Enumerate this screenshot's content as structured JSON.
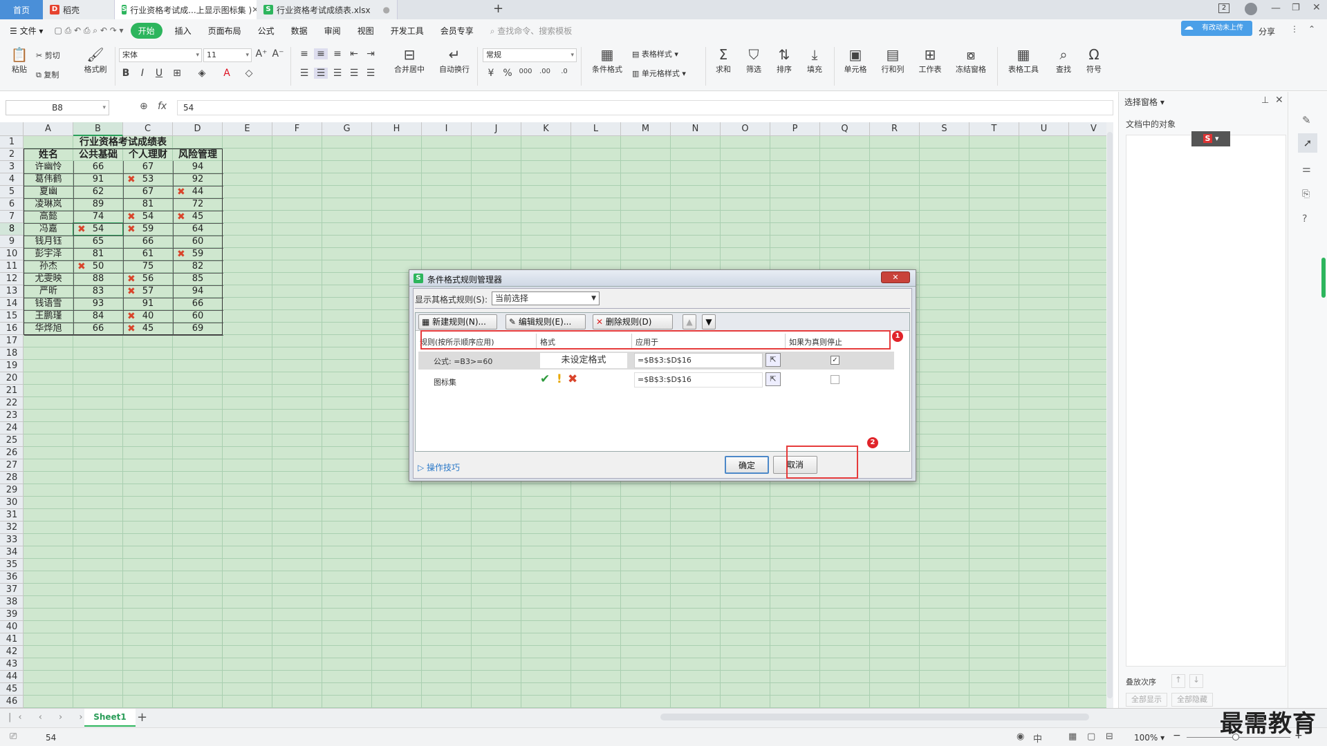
{
  "tabs": {
    "home": "首页",
    "daoke": "稻壳",
    "active": "行业资格考试成...上显示图标集 )",
    "other": "行业资格考试成绩表.xlsx"
  },
  "menu": [
    "文件",
    "开始",
    "插入",
    "页面布局",
    "公式",
    "数据",
    "审阅",
    "视图",
    "开发工具",
    "会员专享"
  ],
  "search_placeholder": "查找命令、搜索模板",
  "top_right": {
    "badge": "2",
    "share": "分享",
    "cloud": "有改动未上传"
  },
  "ribbon": {
    "paste": "粘贴",
    "cut": "剪切",
    "copy": "复制",
    "format_painter": "格式刷",
    "font": "宋体",
    "size": "11",
    "number_format": "常规",
    "merge": "合并居中",
    "wrap": "自动换行",
    "cond_format": "条件格式",
    "table_style": "表格样式",
    "cell_style": "单元格样式",
    "sum": "求和",
    "filter": "筛选",
    "sort": "排序",
    "fill": "填充",
    "cell": "单元格",
    "rowcol": "行和列",
    "worksheet": "工作表",
    "freeze": "冻结窗格",
    "table_tools": "表格工具",
    "find": "查找",
    "symbol": "符号"
  },
  "formula_bar": {
    "name_box": "B8",
    "fx": "fx",
    "value": "54"
  },
  "columns": [
    "A",
    "B",
    "C",
    "D",
    "E",
    "F",
    "G",
    "H",
    "I",
    "J",
    "K",
    "L",
    "M",
    "N",
    "O",
    "P",
    "Q",
    "R",
    "S",
    "T",
    "U",
    "V"
  ],
  "rows": [
    "1",
    "2",
    "3",
    "4",
    "5",
    "6",
    "7",
    "8",
    "9",
    "10",
    "11",
    "12",
    "13",
    "14",
    "15",
    "16",
    "17",
    "18",
    "19",
    "20",
    "21",
    "22",
    "23",
    "24",
    "25",
    "26",
    "27",
    "28",
    "29",
    "30",
    "31",
    "32",
    "33",
    "34",
    "35",
    "36",
    "37",
    "38",
    "39",
    "40",
    "41",
    "42",
    "43",
    "44",
    "45",
    "46"
  ],
  "sheet": {
    "title": "行业资格考试成绩表",
    "headers": [
      "姓名",
      "公共基础",
      "个人理财",
      "风险管理"
    ],
    "data": [
      [
        "许幽怜",
        "66",
        "67",
        "94"
      ],
      [
        "葛伟鹤",
        "91",
        "53",
        "92"
      ],
      [
        "夏幽",
        "62",
        "67",
        "44"
      ],
      [
        "凌琳岚",
        "89",
        "81",
        "72"
      ],
      [
        "高懿",
        "74",
        "54",
        "45"
      ],
      [
        "冯嘉",
        "54",
        "59",
        "64"
      ],
      [
        "钱月钰",
        "65",
        "66",
        "60"
      ],
      [
        "彭宇泽",
        "81",
        "61",
        "59"
      ],
      [
        "孙杰",
        "50",
        "75",
        "82"
      ],
      [
        "尤雯映",
        "88",
        "56",
        "85"
      ],
      [
        "严昕",
        "83",
        "57",
        "94"
      ],
      [
        "钱语雪",
        "93",
        "91",
        "66"
      ],
      [
        "王鹏瑾",
        "84",
        "40",
        "60"
      ],
      [
        "华烨旭",
        "66",
        "45",
        "69"
      ]
    ]
  },
  "dialog": {
    "title": "条件格式规则管理器",
    "show_label": "显示其格式规则(S):",
    "show_value": "当前选择",
    "new_rule": "新建规则(N)...",
    "edit_rule": "编辑规则(E)...",
    "delete_rule": "删除规则(D)",
    "col_rule": "规则(按所示顺序应用)",
    "col_format": "格式",
    "col_applies": "应用于",
    "col_stop": "如果为真则停止",
    "rule1": {
      "name": "公式: =B3>=60",
      "format": "未设定格式",
      "applies": "=$B$3:$D$16",
      "stop": true
    },
    "rule2": {
      "name": "图标集",
      "applies": "=$B$3:$D$16",
      "stop": false
    },
    "tips": "操作技巧",
    "ok": "确定",
    "cancel": "取消",
    "badge1": "1",
    "badge2": "2"
  },
  "right_panel": {
    "title": "选择窗格",
    "objects": "文档中的对象",
    "order": "叠放次序",
    "show_all": "全部显示",
    "hide_all": "全部隐藏"
  },
  "sheet_tab": "Sheet1",
  "status": {
    "value": "54",
    "zoom": "100%"
  },
  "watermark": "最需教育"
}
